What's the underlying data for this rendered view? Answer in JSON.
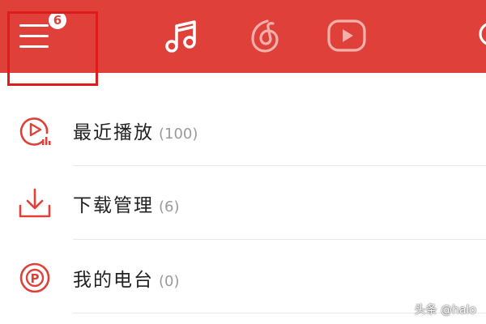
{
  "header": {
    "menu_badge": "6",
    "tabs": [
      {
        "icon": "music-note-icon",
        "active": true
      },
      {
        "icon": "netease-cloud-icon",
        "active": false
      },
      {
        "icon": "video-play-icon",
        "active": false
      }
    ],
    "accent_color": "#e0403a"
  },
  "menu": [
    {
      "label": "最近播放",
      "count": "(100)",
      "icon": "recent-play-icon"
    },
    {
      "label": "下载管理",
      "count": "(6)",
      "icon": "download-icon"
    },
    {
      "label": "我的电台",
      "count": "(0)",
      "icon": "radio-icon"
    }
  ],
  "watermark": "头条 @halo"
}
